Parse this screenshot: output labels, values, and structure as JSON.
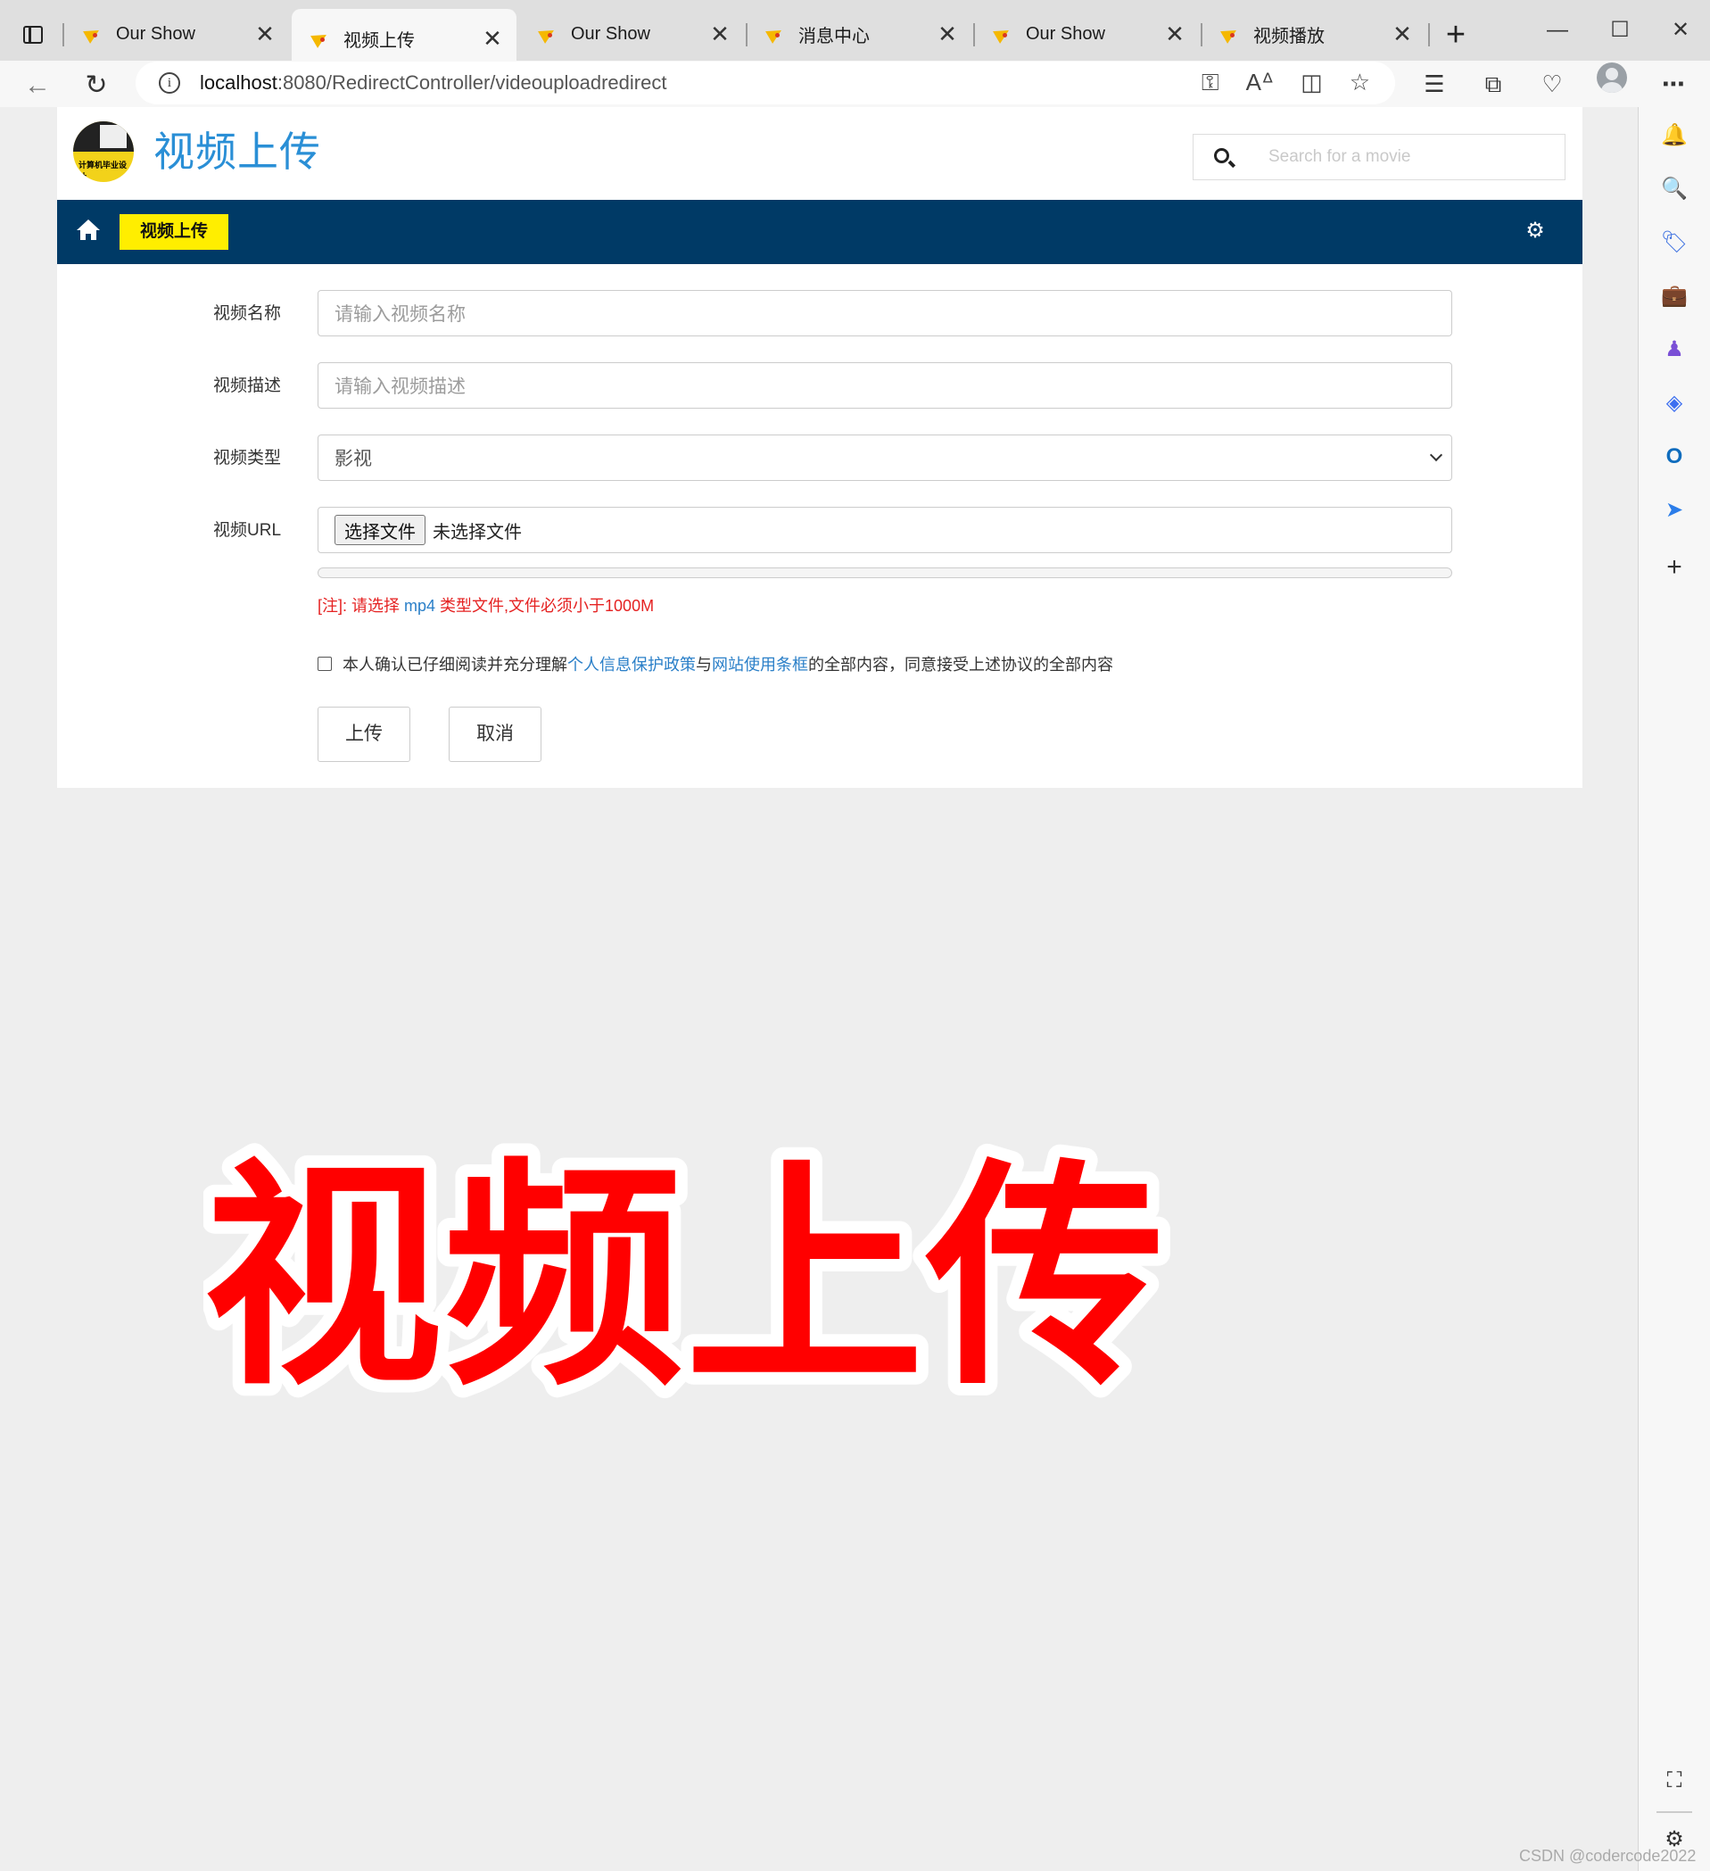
{
  "browser": {
    "tabs": [
      {
        "title": "Our Show",
        "active": false
      },
      {
        "title": "视频上传",
        "active": true
      },
      {
        "title": "Our Show",
        "active": false
      },
      {
        "title": "消息中心",
        "active": false
      },
      {
        "title": "Our Show",
        "active": false
      },
      {
        "title": "视频播放",
        "active": false
      }
    ],
    "close_glyph": "✕",
    "new_tab_glyph": "+",
    "url_host": "localhost",
    "url_path": ":8080/RedirectController/videouploadredirect"
  },
  "site": {
    "logo_text": "计算机毕业设计",
    "title": "视频上传",
    "search_placeholder": "Search for a movie",
    "nav_active": "视频上传"
  },
  "form": {
    "name_label": "视频名称",
    "name_placeholder": "请输入视频名称",
    "desc_label": "视频描述",
    "desc_placeholder": "请输入视频描述",
    "type_label": "视频类型",
    "type_value": "影视",
    "url_label": "视频URL",
    "file_button": "选择文件",
    "file_status": "未选择文件",
    "upload_progress": 0,
    "note_prefix": "[注]: 请选择 ",
    "note_format": "mp4",
    "note_suffix": " 类型文件,文件必须小于1000M",
    "agree_text_1": "本人确认已仔细阅读并充分理解 ",
    "agree_link_1": "个人信息保护政策",
    "agree_text_2": "与 ",
    "agree_link_2": "网站使用条框",
    "agree_text_3": " 的全部内容，同意接受上述协议的全部内容",
    "agree_checked": false,
    "submit_label": "上传",
    "cancel_label": "取消"
  },
  "overlay": {
    "text": "视频上传",
    "color": "#ff0000",
    "outline": "#ffffff"
  },
  "watermark": "CSDN @codercode2022",
  "colors": {
    "navbar": "#003a66",
    "nav_active": "#ffee00",
    "title_blue": "#2a8fd6",
    "note_red": "#e52222",
    "link_blue": "#2a7fc8"
  }
}
